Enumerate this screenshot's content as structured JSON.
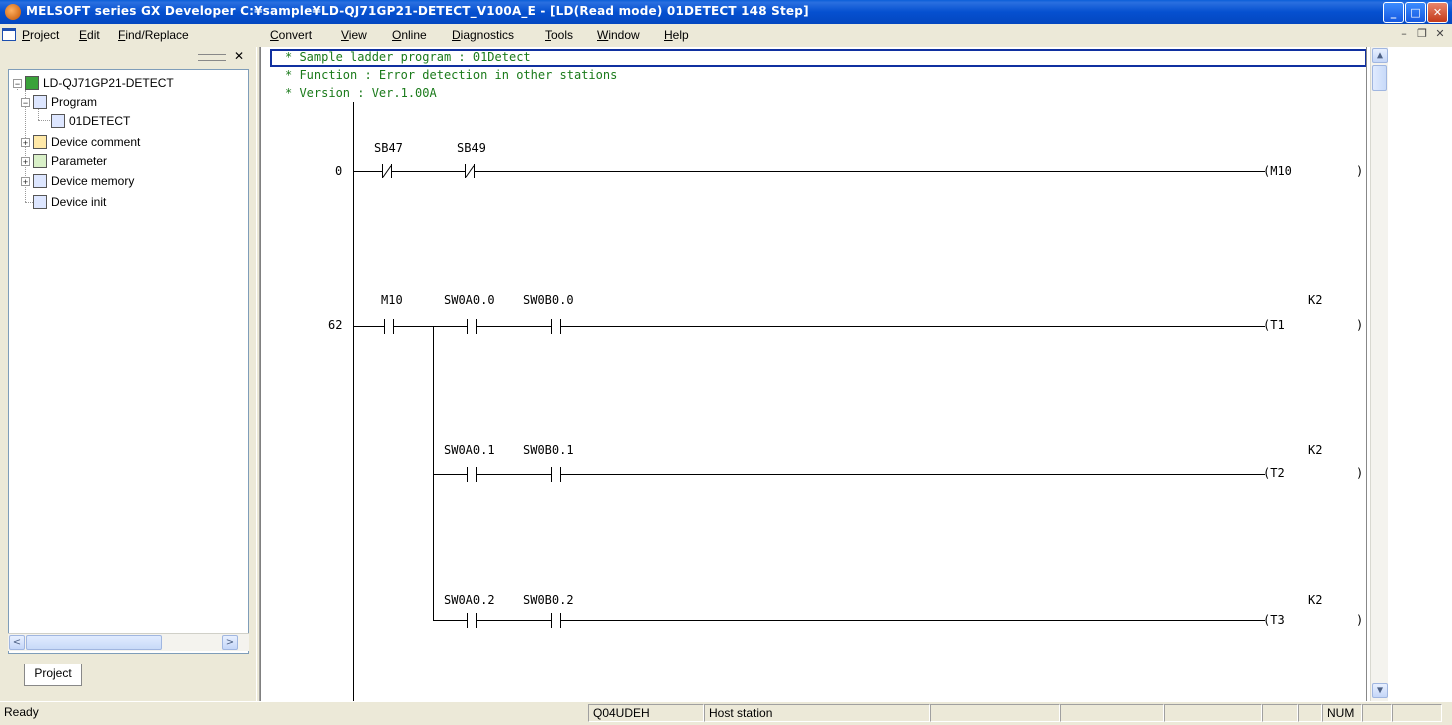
{
  "window": {
    "title": "MELSOFT series GX Developer C:¥sample¥LD-QJ71GP21-DETECT_V100A_E - [LD(Read mode)    01DETECT   148 Step]",
    "controls": {
      "minimize": "_",
      "maximize": "□",
      "close": "✕"
    }
  },
  "menu": {
    "items": [
      "Project",
      "Edit",
      "Find/Replace",
      "Convert",
      "View",
      "Online",
      "Diagnostics",
      "Tools",
      "Window",
      "Help"
    ],
    "mdi_controls": {
      "minimize": "–",
      "restore": "❐",
      "close": "✕"
    }
  },
  "project_pane": {
    "close": "✕",
    "tree": {
      "root": "LD-QJ71GP21-DETECT",
      "program": "Program",
      "program_child": "01DETECT",
      "device_comment": "Device comment",
      "parameter": "Parameter",
      "device_memory": "Device memory",
      "device_init": "Device init"
    },
    "tab": "Project",
    "scroll_left": "<",
    "scroll_right": ">"
  },
  "ladder": {
    "comments": [
      "* Sample ladder program : 01Detect",
      "* Function : Error detection in other stations",
      "* Version : Ver.1.00A"
    ],
    "rung0": {
      "step": "0",
      "c1": "SB47",
      "c2": "SB49",
      "coil": "M10"
    },
    "rung62": {
      "step": "62",
      "c1": "M10",
      "branches": [
        {
          "a": "SW0A0.0",
          "b": "SW0B0.0",
          "coil": "T1",
          "const": "K2"
        },
        {
          "a": "SW0A0.1",
          "b": "SW0B0.1",
          "coil": "T2",
          "const": "K2"
        },
        {
          "a": "SW0A0.2",
          "b": "SW0B0.2",
          "coil": "T3",
          "const": "K2"
        }
      ]
    },
    "scroll_up": "▲",
    "scroll_down": "▼"
  },
  "status": {
    "ready": "Ready",
    "cpu": "Q04UDEH",
    "station": "Host station",
    "num": "NUM"
  },
  "colors": {
    "title_bar": "#0550d0",
    "comment_text": "#1a7a1a",
    "cursor_border": "#1030a0"
  }
}
